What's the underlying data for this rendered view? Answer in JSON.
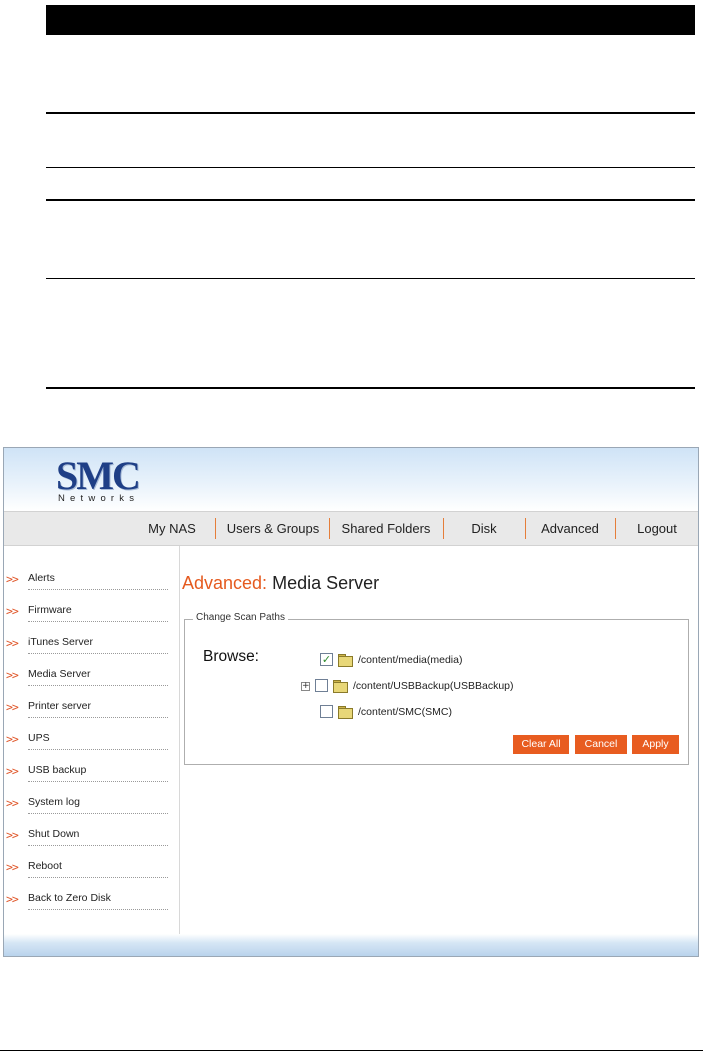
{
  "app": {
    "logo_main": "SMC",
    "logo_sub": "Networks"
  },
  "nav": {
    "items": [
      "My NAS",
      "Users & Groups",
      "Shared Folders",
      "Disk",
      "Advanced",
      "Logout"
    ]
  },
  "sidebar": {
    "arrow": ">>",
    "items": [
      "Alerts",
      "Firmware",
      "iTunes Server",
      "Media Server",
      "Printer server",
      "UPS",
      "USB backup",
      "System log",
      "Shut Down",
      "Reboot",
      "Back to Zero Disk"
    ]
  },
  "page": {
    "title_prefix": "Advanced:",
    "title_rest": "Media Server"
  },
  "scan": {
    "legend": "Change Scan Paths",
    "browse_label": "Browse:",
    "paths": [
      {
        "label": "/content/media(media)",
        "checked": true
      },
      {
        "label": "/content/USBBackup(USBBackup)",
        "checked": false,
        "expander": "+"
      },
      {
        "label": "/content/SMC(SMC)",
        "checked": false
      }
    ],
    "checkmark": "✓"
  },
  "buttons": {
    "clear_all": "Clear All",
    "cancel": "Cancel",
    "apply": "Apply"
  },
  "colors": {
    "accent": "#e85c20",
    "nav_separator": "#e57e3a",
    "logo": "#1f3f86"
  }
}
